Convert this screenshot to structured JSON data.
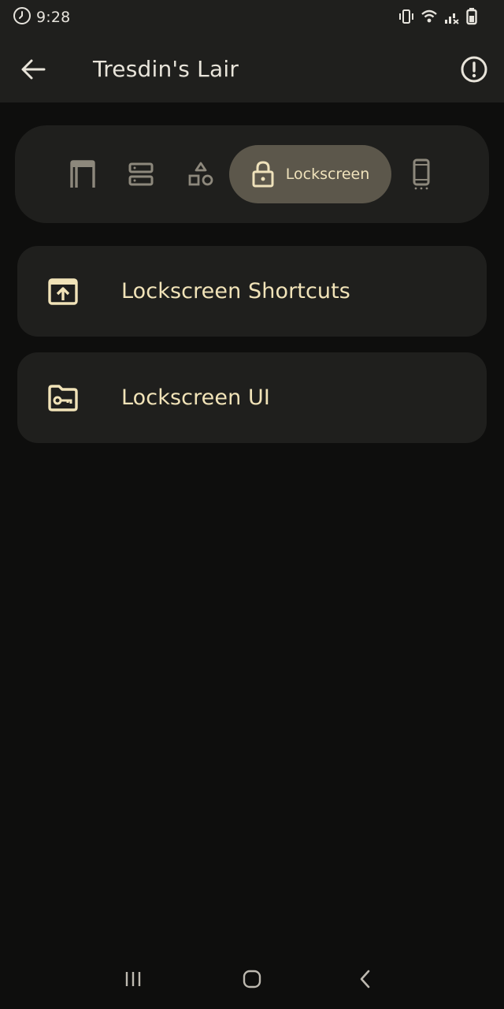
{
  "status_bar": {
    "time": "9:28"
  },
  "app_bar": {
    "title": "Tresdin's Lair"
  },
  "tabs": [
    {
      "icon": "window-icon",
      "label": ""
    },
    {
      "icon": "server-icon",
      "label": ""
    },
    {
      "icon": "shapes-icon",
      "label": ""
    },
    {
      "icon": "lock-icon",
      "label": "Lockscreen",
      "active": true
    },
    {
      "icon": "phone-icon",
      "label": ""
    }
  ],
  "items": [
    {
      "icon": "open-in-app-icon",
      "label": "Lockscreen Shortcuts"
    },
    {
      "icon": "folder-key-icon",
      "label": "Lockscreen UI"
    }
  ],
  "colors": {
    "background": "#0e0e0d",
    "surface": "#1f1f1d",
    "active_pill": "#5c574b",
    "accent_text": "#f1e3b8",
    "inactive_icon": "#8d887c"
  }
}
